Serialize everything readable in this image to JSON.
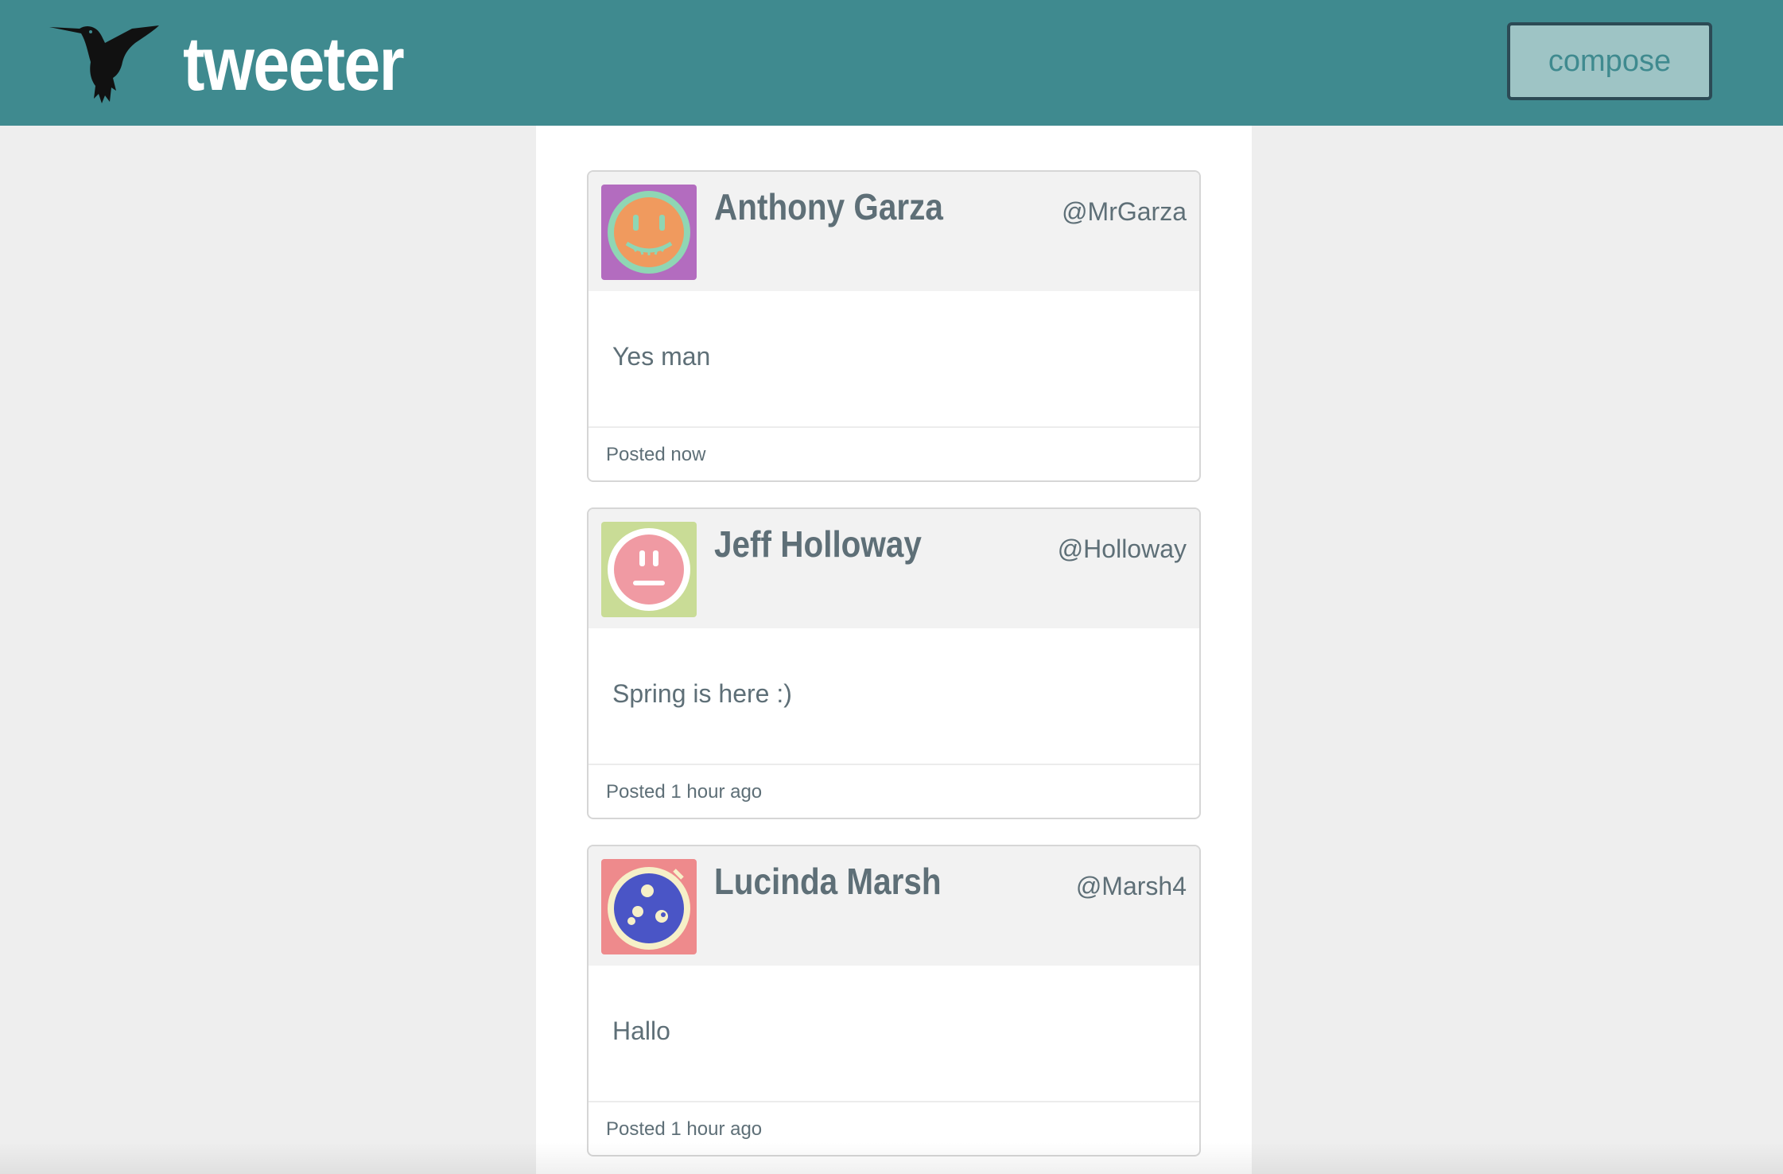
{
  "header": {
    "logo_icon": "hummingbird-icon",
    "brand": "tweeter",
    "compose_label": "compose",
    "colors": {
      "background": "#3f8a8f",
      "compose_bg": "#9ec4c5",
      "compose_border": "#2c4a55"
    }
  },
  "tweets": [
    {
      "name": "Anthony Garza",
      "handle": "@MrGarza",
      "text": "Yes man",
      "time": "Posted now",
      "avatar": {
        "icon": "grinning-face-avatar-icon",
        "bg": "#b36cbf",
        "ring": "#8fd6b4",
        "face": "#f09a5e"
      }
    },
    {
      "name": "Jeff Holloway",
      "handle": "@Holloway",
      "text": "Spring is here :)",
      "time": "Posted 1 hour ago",
      "avatar": {
        "icon": "neutral-face-avatar-icon",
        "bg": "#c9dc96",
        "ring": "#ffffff",
        "face": "#f09aa3"
      }
    },
    {
      "name": "Lucinda Marsh",
      "handle": "@Marsh4",
      "text": "Hallo",
      "time": "Posted 1 hour ago",
      "avatar": {
        "icon": "dots-face-avatar-icon",
        "bg": "#ee8a8c",
        "ring": "#f6f0c8",
        "face": "#4a55c6"
      }
    }
  ]
}
